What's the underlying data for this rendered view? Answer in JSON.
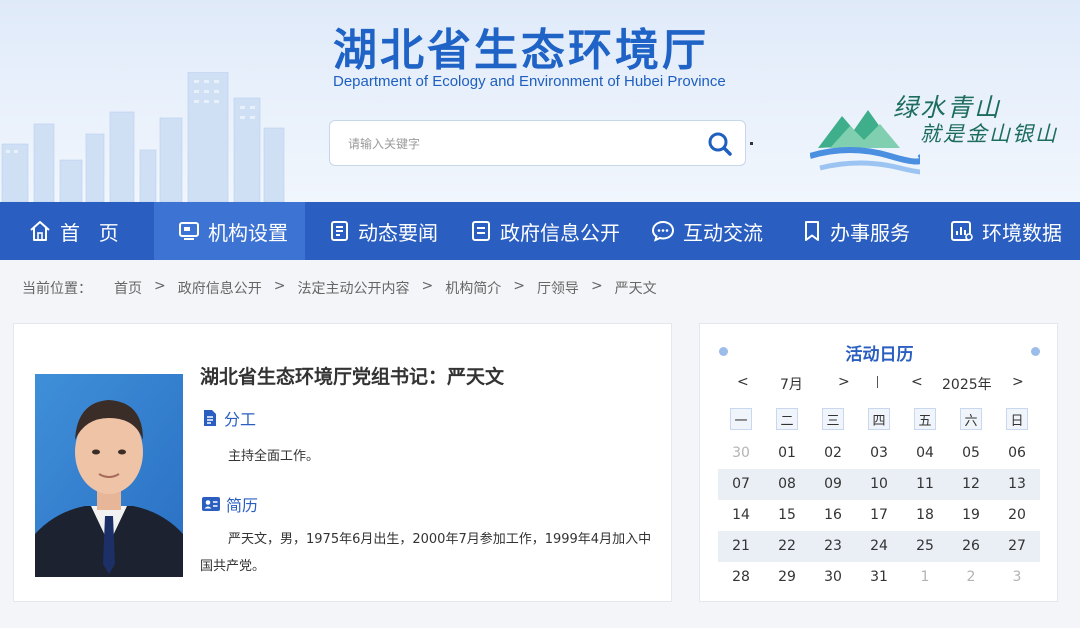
{
  "header": {
    "title_cn": "湖北省生态环境厅",
    "title_en": "Department of Ecology and Environment of Hubei Province",
    "search_placeholder": "请输入关键字",
    "slogan_line1": "绿水青山",
    "slogan_line2": "就是金山银山"
  },
  "nav": {
    "items": [
      {
        "label": "首  页",
        "icon": "home-icon"
      },
      {
        "label": "机构设置",
        "icon": "monitor-icon",
        "active": true
      },
      {
        "label": "动态要闻",
        "icon": "news-icon"
      },
      {
        "label": "政府信息公开",
        "icon": "document-icon"
      },
      {
        "label": "互动交流",
        "icon": "chat-icon"
      },
      {
        "label": "办事服务",
        "icon": "bookmark-icon"
      },
      {
        "label": "环境数据",
        "icon": "chart-icon"
      }
    ]
  },
  "breadcrumb": {
    "prefix": "当前位置：",
    "items": [
      "首页",
      "政府信息公开",
      "法定主动公开内容",
      "机构简介",
      "厅领导",
      "严天文"
    ],
    "separator": ">"
  },
  "leader": {
    "title": "湖北省生态环境厅党组书记：严天文",
    "duty_heading": "分工",
    "duty_text": "主持全面工作。",
    "resume_heading": "简历",
    "resume_text": "严天文，男，1975年6月出生，2000年7月参加工作，1999年4月加入中国共产党。"
  },
  "calendar": {
    "title": "活动日历",
    "prev": "<",
    "next": ">",
    "month": "7月",
    "year": "2025年",
    "weekdays": [
      "一",
      "二",
      "三",
      "四",
      "五",
      "六",
      "日"
    ],
    "rows": [
      [
        "30",
        "01",
        "02",
        "03",
        "04",
        "05",
        "06"
      ],
      [
        "07",
        "08",
        "09",
        "10",
        "11",
        "12",
        "13"
      ],
      [
        "14",
        "15",
        "16",
        "17",
        "18",
        "19",
        "20"
      ],
      [
        "21",
        "22",
        "23",
        "24",
        "25",
        "26",
        "27"
      ],
      [
        "28",
        "29",
        "30",
        "31",
        "1",
        "2",
        "3"
      ]
    ]
  },
  "colors": {
    "brand_blue": "#2a5fc1",
    "nav_active": "#3d73d3"
  }
}
